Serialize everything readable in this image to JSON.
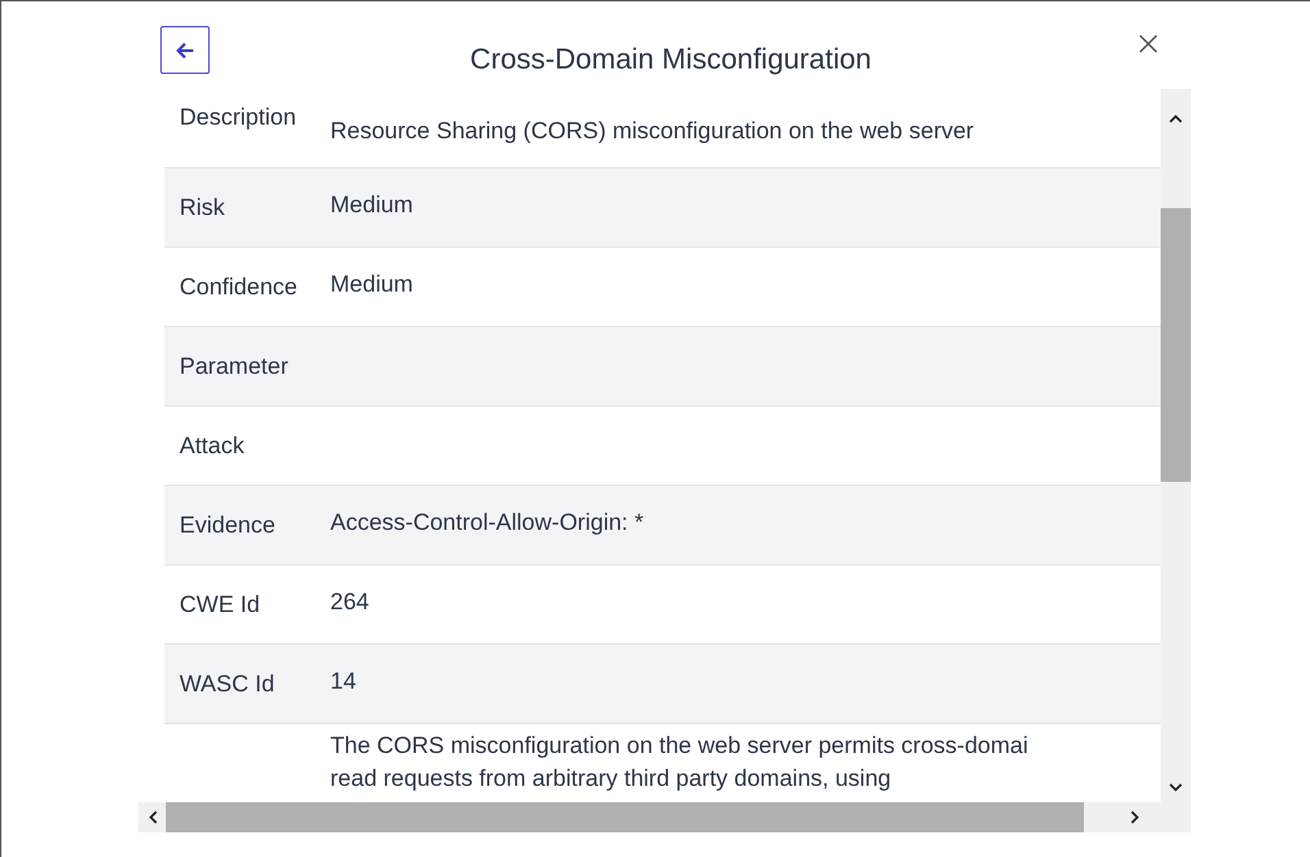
{
  "dialog": {
    "title": "Cross-Domain Misconfiguration"
  },
  "rows": [
    {
      "label": "Description",
      "lines": [
        "Resource Sharing (CORS) misconfiguration on the web server"
      ]
    },
    {
      "label": "Risk",
      "lines": [
        "Medium"
      ]
    },
    {
      "label": "Confidence",
      "lines": [
        "Medium"
      ]
    },
    {
      "label": "Parameter",
      "lines": []
    },
    {
      "label": "Attack",
      "lines": []
    },
    {
      "label": "Evidence",
      "lines": [
        "Access-Control-Allow-Origin: *"
      ]
    },
    {
      "label": "CWE Id",
      "lines": [
        "264"
      ]
    },
    {
      "label": "WASC Id",
      "lines": [
        "14"
      ]
    },
    {
      "lines": [
        "The CORS misconfiguration on the web server permits cross-domai",
        "read requests from arbitrary third party domains, using"
      ]
    }
  ]
}
